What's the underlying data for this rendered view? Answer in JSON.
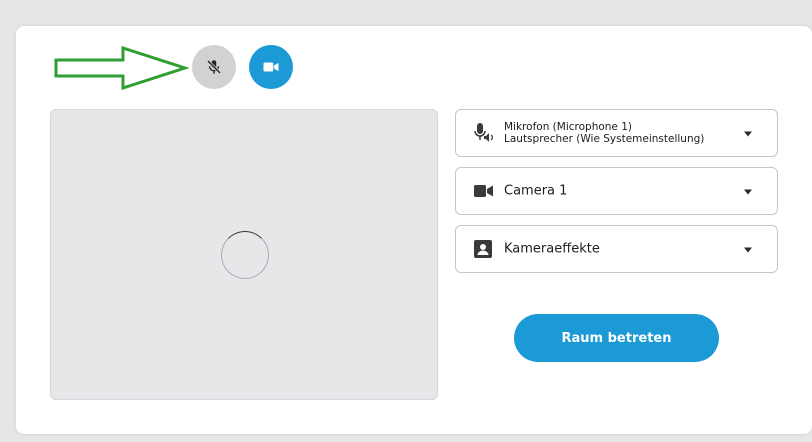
{
  "controls": {
    "mic_button_state": "muted",
    "camera_button_state": "on"
  },
  "preview": {
    "state": "loading"
  },
  "audio_select": {
    "microphone": "Mikrofon (Microphone 1)",
    "speaker": "Lautsprecher (Wie Systemeinstellung)"
  },
  "camera_select": {
    "value": "Camera 1"
  },
  "effects_select": {
    "value": "Kameraeffekte"
  },
  "join_button": {
    "label": "Raum betreten"
  },
  "colors": {
    "accent": "#1c9ad6",
    "arrow": "#2f9e33",
    "mic_button_bg": "#d2d2d4"
  },
  "icons": {
    "arrow": "arrow-right-icon",
    "mic_off": "mic-off-icon",
    "video": "video-camera-icon",
    "mic_speaker": "mic-speaker-icon",
    "person_box": "person-box-icon"
  }
}
